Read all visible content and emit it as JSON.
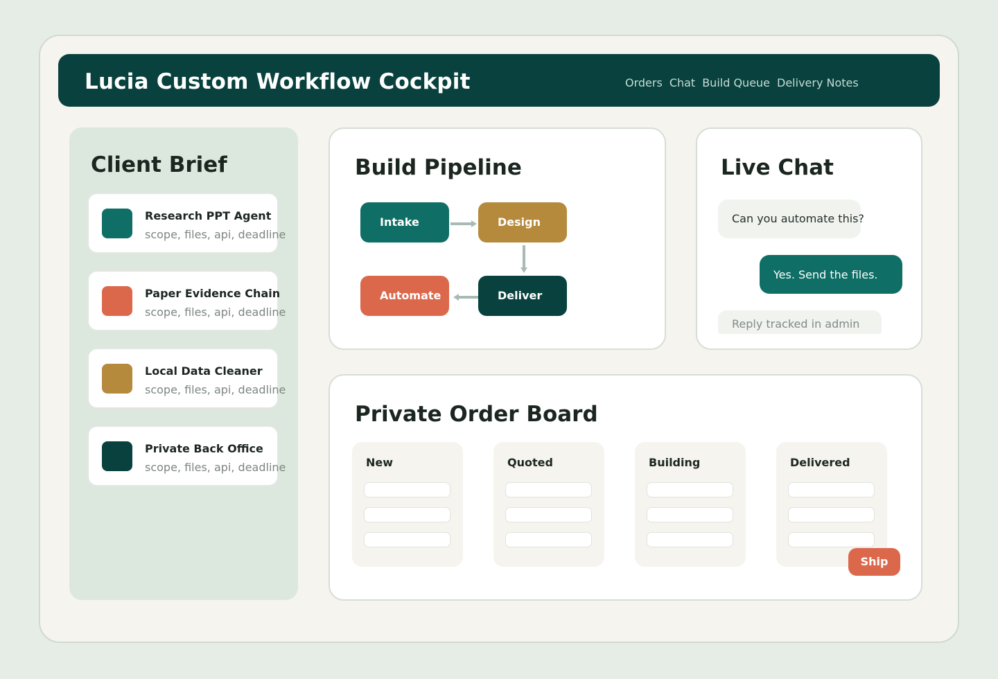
{
  "header": {
    "title": "Lucia Custom Workflow Cockpit",
    "nav": [
      "Orders",
      "Chat",
      "Build Queue",
      "Delivery Notes"
    ]
  },
  "brief": {
    "title": "Client Brief",
    "items": [
      {
        "name": "Research PPT Agent",
        "sub": "scope, files, api, deadline",
        "color": "#0f6e66"
      },
      {
        "name": "Paper Evidence Chain",
        "sub": "scope, files, api, deadline",
        "color": "#dc684c"
      },
      {
        "name": "Local Data Cleaner",
        "sub": "scope, files, api, deadline",
        "color": "#b68a3c"
      },
      {
        "name": "Private Back Office",
        "sub": "scope, files, api, deadline",
        "color": "#08413d"
      }
    ]
  },
  "pipeline": {
    "title": "Build Pipeline",
    "nodes": [
      {
        "label": "Intake",
        "color": "#0f6e66"
      },
      {
        "label": "Design",
        "color": "#b68a3c"
      },
      {
        "label": "Automate",
        "color": "#dc684c"
      },
      {
        "label": "Deliver",
        "color": "#08413d"
      }
    ]
  },
  "chat": {
    "title": "Live Chat",
    "incoming": "Can you automate this?",
    "outgoing": "Yes. Send the files.",
    "reply_placeholder": "Reply tracked in admin"
  },
  "board": {
    "title": "Private Order Board",
    "columns": [
      "New",
      "Quoted",
      "Building",
      "Delivered"
    ],
    "ship_label": "Ship"
  },
  "colors": {
    "primary_dark": "#08413d",
    "teal": "#0f6e66",
    "gold": "#b68a3c",
    "coral": "#dc684c",
    "sage": "#dce8de"
  }
}
